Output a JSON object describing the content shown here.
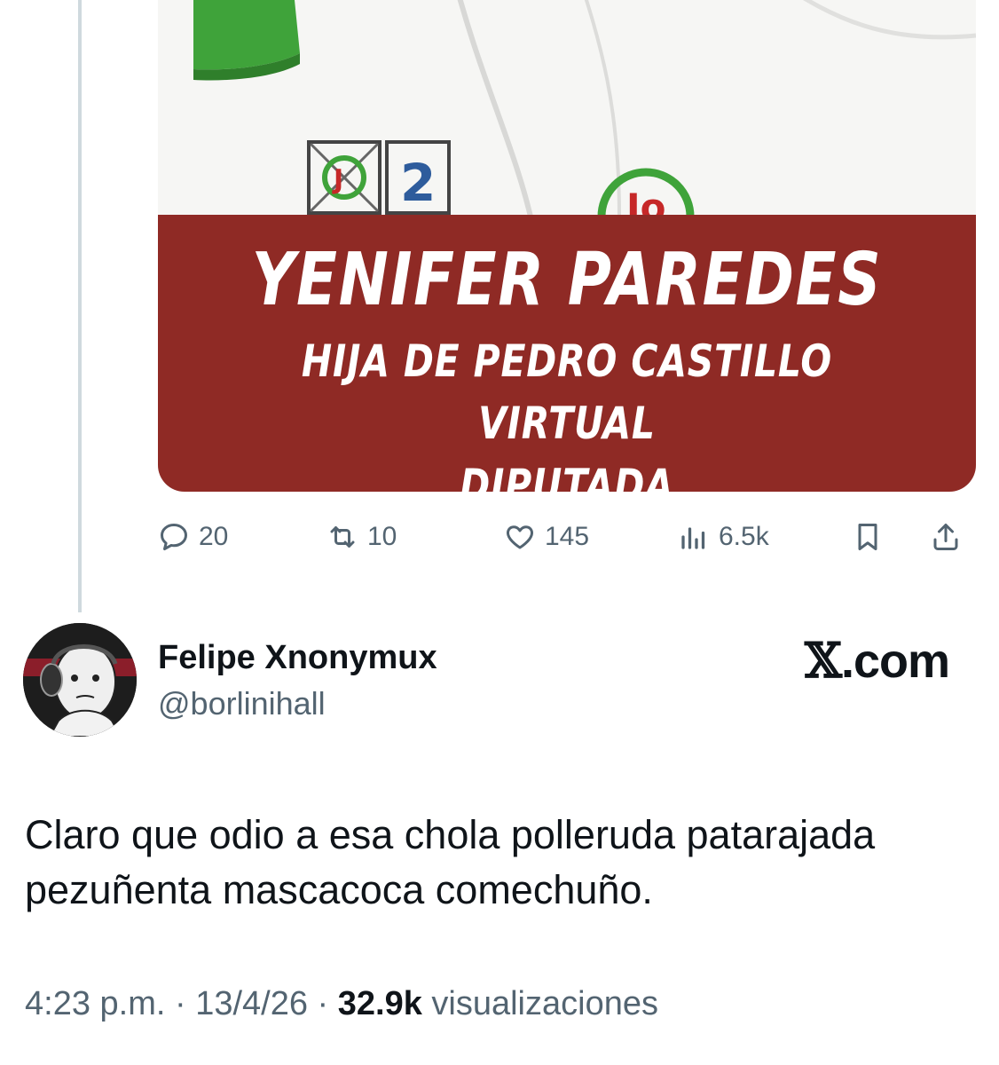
{
  "quoted_post": {
    "image": {
      "ballot_number": "2",
      "banner_title": "YENIFER PAREDES",
      "banner_subtitle": "HIJA DE PEDRO CASTILLO VIRTUAL\nDIPUTADA",
      "banner_color": "#8f2a25"
    },
    "actions": {
      "replies": "20",
      "reposts": "10",
      "likes": "145",
      "views": "6.5k"
    }
  },
  "post": {
    "author": {
      "display_name": "Felipe Xnonymux",
      "handle": "@borlinihall"
    },
    "brand_x": "𝕏",
    "brand_domain": ".com",
    "text": "Claro que odio a esa chola polleruda patarajada pezuñenta mascacoca comechuño.",
    "time": "4:23 p.m. · 13/4/26 ·",
    "views_count": "32.9k",
    "views_label": "visualizaciones"
  },
  "colors": {
    "secondary_text": "#536471",
    "thread_line": "#cfd9de",
    "primary_text": "#0f1419"
  },
  "icons": [
    "reply-icon",
    "repost-icon",
    "like-icon",
    "views-icon",
    "bookmark-icon",
    "share-icon"
  ]
}
